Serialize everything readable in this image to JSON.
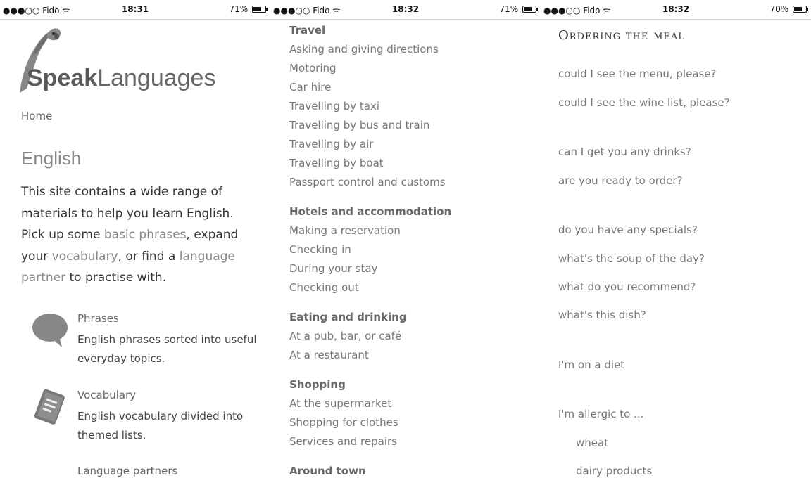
{
  "status_bars": [
    {
      "signal": "●●●○○",
      "carrier": "Fido",
      "wifi": "ᯤ",
      "time": "18:31",
      "battery_text": "71%",
      "battery_level": 0.71
    },
    {
      "signal": "●●●○○",
      "carrier": "Fido",
      "wifi": "ᯤ",
      "time": "18:32",
      "battery_text": "71%",
      "battery_level": 0.71
    },
    {
      "signal": "●●●○○",
      "carrier": "Fido",
      "wifi": "ᯤ",
      "time": "18:32",
      "battery_text": "70%",
      "battery_level": 0.7
    }
  ],
  "logo": {
    "bold": "Speak",
    "light": "Languages",
    "icon": "parrot-icon"
  },
  "home_link": "Home",
  "page_title": "English",
  "intro": {
    "part1": "This site contains a wide range of materials to help you learn English. Pick up some ",
    "link1": "basic phrases",
    "part2": ", expand your ",
    "link2": "vocabulary",
    "part3": ", or find a ",
    "link3": "language partner",
    "part4": " to practise with."
  },
  "features": [
    {
      "icon": "speech-bubble-icon",
      "title": "Phrases",
      "desc": "English phrases sorted into useful everyday topics."
    },
    {
      "icon": "book-icon",
      "title": "Vocabulary",
      "desc": "English vocabulary divided into themed lists."
    },
    {
      "icon": "",
      "title": "Language partners",
      "desc": ""
    }
  ],
  "menu": [
    {
      "section": "Travel",
      "items": [
        "Asking and giving directions",
        "Motoring",
        "Car hire",
        "Travelling by taxi",
        "Travelling by bus and train",
        "Travelling by air",
        "Travelling by boat",
        "Passport control and customs"
      ]
    },
    {
      "section": "Hotels and accommodation",
      "items": [
        "Making a reservation",
        "Checking in",
        "During your stay",
        "Checking out"
      ]
    },
    {
      "section": "Eating and drinking",
      "items": [
        "At a pub, bar, or café",
        "At a restaurant"
      ]
    },
    {
      "section": "Shopping",
      "items": [
        "At the supermarket",
        "Shopping for clothes",
        "Services and repairs"
      ]
    },
    {
      "section": "Around town",
      "items": []
    }
  ],
  "ordering": {
    "title": "Ordering the meal",
    "phrases": [
      "could I see the menu, please?",
      "could I see the wine list, please?",
      "can I get you any drinks?",
      "are you ready to order?",
      "do you have any specials?",
      "what's the soup of the day?",
      "what do you recommend?",
      "what's this dish?",
      "I'm on a diet",
      "I'm allergic to ...",
      "wheat",
      "dairy products"
    ]
  }
}
